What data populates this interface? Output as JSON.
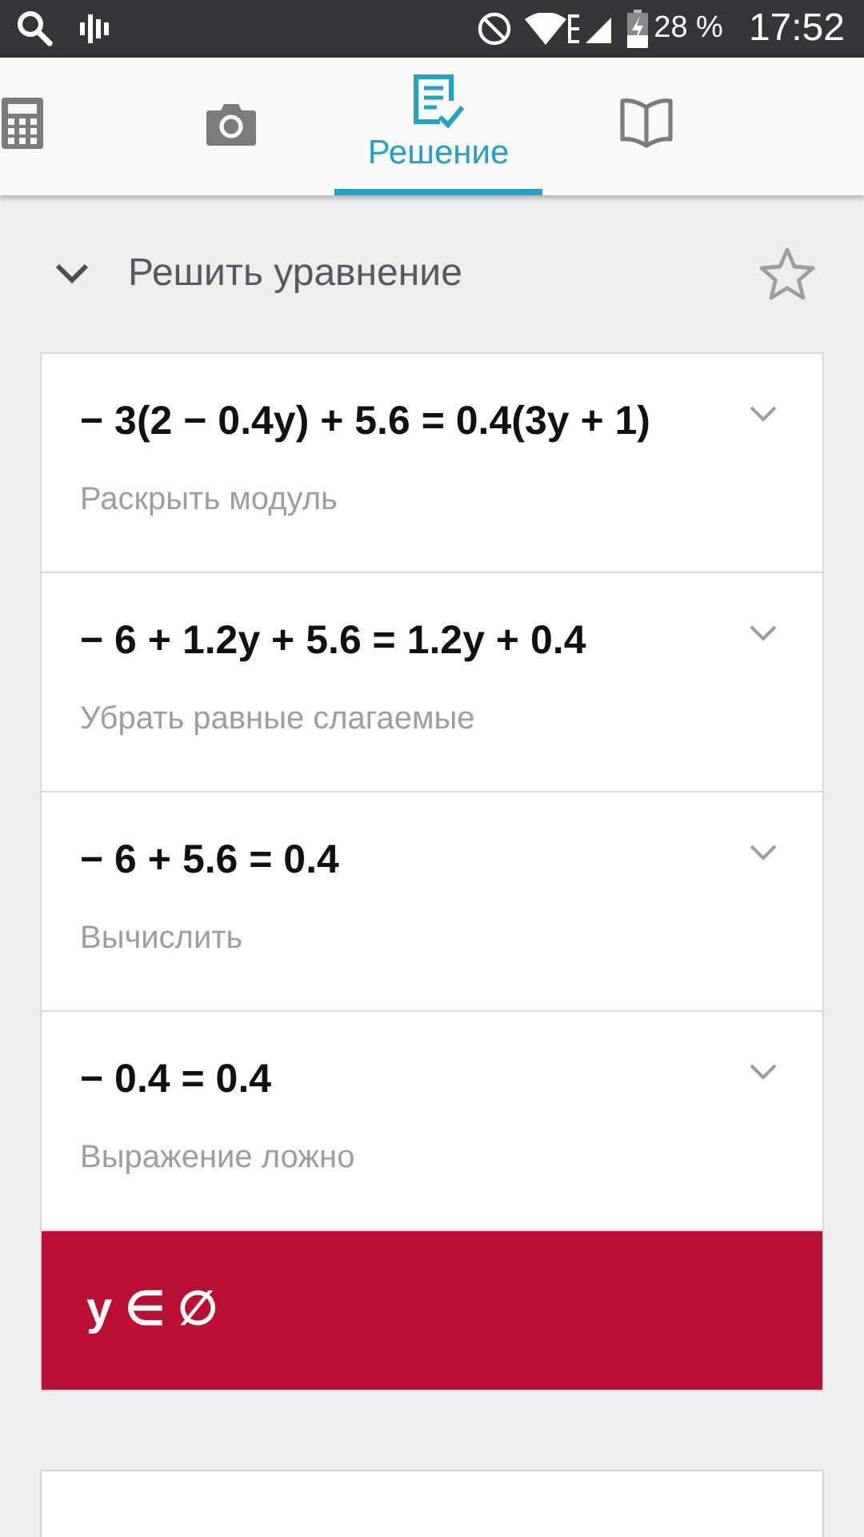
{
  "status_bar": {
    "battery": "28 %",
    "time": "17:52"
  },
  "tabs": [
    {
      "selected": false
    },
    {
      "selected": false
    },
    {
      "label": "Решение",
      "selected": true
    },
    {
      "selected": false
    }
  ],
  "header": {
    "title": "Решить уравнение",
    "expanded": true
  },
  "steps": [
    {
      "equation": "− 3(2 − 0.4y) + 5.6 = 0.4(3y + 1)",
      "description": "Раскрыть модуль"
    },
    {
      "equation": "− 6 + 1.2y + 5.6 = 1.2y + 0.4",
      "description": "Убрать равные слагаемые"
    },
    {
      "equation": "− 6 + 5.6 = 0.4",
      "description": "Вычислить"
    },
    {
      "equation": "− 0.4 = 0.4",
      "description": "Выражение ложно"
    }
  ],
  "result": "y ∈ ∅"
}
